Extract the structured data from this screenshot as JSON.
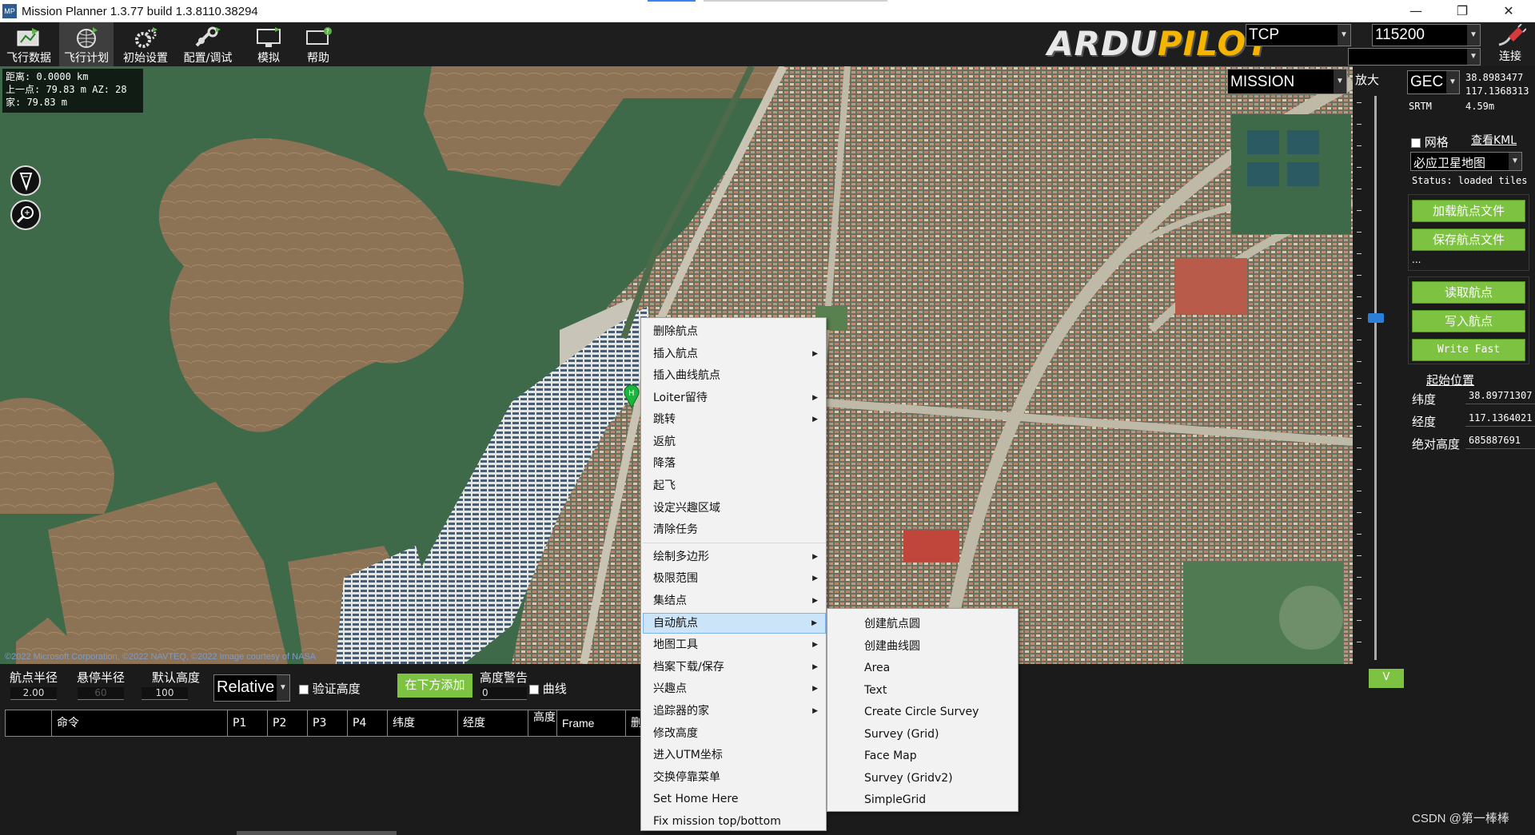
{
  "window": {
    "title": "Mission Planner 1.3.77 build 1.3.8110.38294",
    "icon_text": "MP",
    "minimize": "—",
    "restore": "❐",
    "close": "✕"
  },
  "toolbar": {
    "items": [
      {
        "label": "飞行数据",
        "icon": "flight-data-icon"
      },
      {
        "label": "飞行计划",
        "icon": "flight-plan-icon"
      },
      {
        "label": "初始设置",
        "icon": "initial-setup-icon"
      },
      {
        "label": "配置/调试",
        "icon": "config-tuning-icon"
      },
      {
        "label": "模拟",
        "icon": "simulation-icon"
      },
      {
        "label": "帮助",
        "icon": "help-icon"
      }
    ],
    "active_item": "飞行计划",
    "logo_a": "ARDU",
    "logo_b": "PILOT",
    "connection_type": "TCP",
    "baud_rate": "115200",
    "connect_label": "连接"
  },
  "map": {
    "distance_line1": "距离: 0.0000 km",
    "distance_line2": "上一点: 79.83 m AZ: 28",
    "distance_line3": "家: 79.83 m",
    "copyright": "©2022 Microsoft Corporation, ©2022 NAVTEQ, ©2022 Image courtesy of NASA",
    "home_marker": "H",
    "mode": "MISSION",
    "zoom_label": "放大"
  },
  "side": {
    "coord_system": "GEC",
    "lat": "38.8983477",
    "lng": "117.1368313",
    "srtm_label": "SRTM",
    "srtm_value": "4.59m",
    "grid_label": "网格",
    "view_kml": "查看KML",
    "map_type": "必应卫星地图",
    "status": "Status: loaded tiles",
    "load_wp": "加载航点文件",
    "save_wp": "保存航点文件",
    "ellipsis": "...",
    "read_wp": "读取航点",
    "write_wp": "写入航点",
    "write_fast": "Write Fast",
    "home_title": "起始位置",
    "home_lat_label": "纬度",
    "home_lat": "38.89771307",
    "home_lng_label": "经度",
    "home_lng": "117.1364021",
    "home_alt_label": "绝对高度",
    "home_alt": "685887691",
    "v_button": "V"
  },
  "bottom": {
    "wp_radius_label": "航点半径",
    "wp_radius": "2.00",
    "loiter_radius_label": "悬停半径",
    "loiter_radius": "60",
    "default_alt_label": "默认高度",
    "default_alt": "100",
    "alt_frame": "Relative",
    "verify_height": "验证高度",
    "add_below": "在下方添加",
    "alt_warn_label": "高度警告",
    "alt_warn": "0",
    "spline": "曲线",
    "columns": [
      "",
      "命令",
      "P1",
      "P2",
      "P3",
      "P4",
      "纬度",
      "经度",
      "高度",
      "Frame",
      "删"
    ]
  },
  "context_menu": {
    "items": [
      {
        "label": "删除航点",
        "submenu": false
      },
      {
        "label": "插入航点",
        "submenu": true
      },
      {
        "label": "插入曲线航点",
        "submenu": false
      },
      {
        "label": "Loiter留待",
        "submenu": true
      },
      {
        "label": "跳转",
        "submenu": true
      },
      {
        "label": "返航",
        "submenu": false
      },
      {
        "label": "降落",
        "submenu": false
      },
      {
        "label": "起飞",
        "submenu": false
      },
      {
        "label": "设定兴趣区域",
        "submenu": false
      },
      {
        "label": "清除任务",
        "submenu": false
      },
      {
        "label": "绘制多边形",
        "submenu": true
      },
      {
        "label": "极限范围",
        "submenu": true
      },
      {
        "label": "集结点",
        "submenu": true
      },
      {
        "label": "自动航点",
        "submenu": true
      },
      {
        "label": "地图工具",
        "submenu": true
      },
      {
        "label": "档案下载/保存",
        "submenu": true
      },
      {
        "label": "兴趣点",
        "submenu": true
      },
      {
        "label": "追踪器的家",
        "submenu": true
      },
      {
        "label": "修改高度",
        "submenu": false
      },
      {
        "label": "进入UTM坐标",
        "submenu": false
      },
      {
        "label": "交换停靠菜单",
        "submenu": false
      },
      {
        "label": "Set Home Here",
        "submenu": false
      },
      {
        "label": "Fix mission top/bottom",
        "submenu": false
      }
    ],
    "highlighted": "自动航点"
  },
  "submenu": {
    "items": [
      "创建航点圆",
      "创建曲线圆",
      "Area",
      "Text",
      "Create Circle Survey",
      "Survey (Grid)",
      "Face Map",
      "Survey (Gridv2)",
      "SimpleGrid"
    ]
  },
  "watermark": "CSDN @第一棒棒",
  "colors": {
    "accent_green": "#7dc241",
    "highlight_blue": "#cce4f7",
    "logo_gold": "#f4b400",
    "lake_green": "#3f6a4a"
  }
}
